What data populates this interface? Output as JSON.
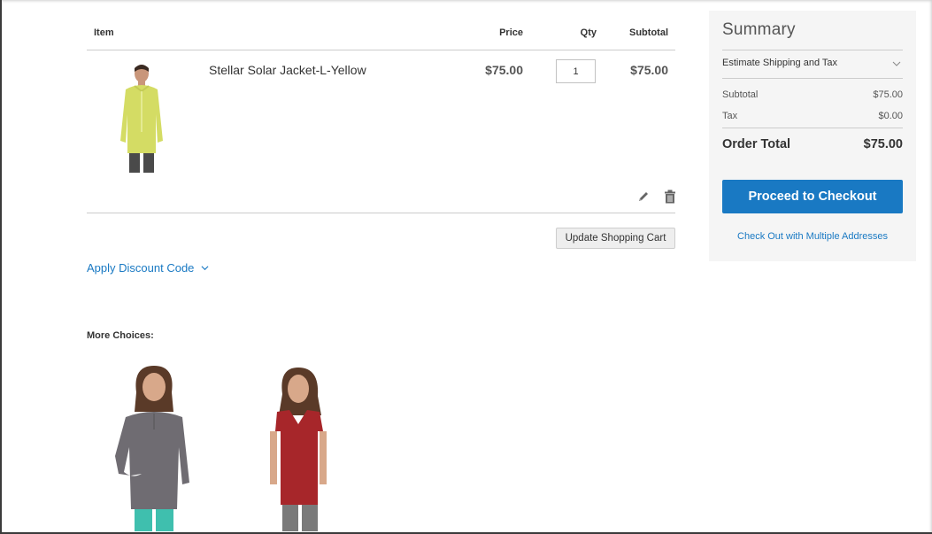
{
  "cart": {
    "headers": {
      "item": "Item",
      "price": "Price",
      "qty": "Qty",
      "subtotal": "Subtotal"
    },
    "items": [
      {
        "name": "Stellar Solar Jacket-L-Yellow",
        "price": "$75.00",
        "qty": "1",
        "subtotal": "$75.00",
        "image": "woman-in-yellow-jacket",
        "actions": [
          "edit-icon",
          "trash-icon"
        ]
      }
    ],
    "update_label": "Update Shopping Cart"
  },
  "discount": {
    "label": "Apply Discount Code"
  },
  "more_choices": {
    "title": "More Choices:",
    "items": [
      {
        "image": "woman-in-gray-quarter-zip-top"
      },
      {
        "image": "woman-in-red-v-neck-tee"
      }
    ]
  },
  "summary": {
    "title": "Summary",
    "estimate_label": "Estimate Shipping and Tax",
    "rows": [
      {
        "label": "Subtotal",
        "value": "$75.00"
      },
      {
        "label": "Tax",
        "value": "$0.00"
      }
    ],
    "order_total_label": "Order Total",
    "order_total_value": "$75.00",
    "checkout_label": "Proceed to Checkout",
    "multi_address_label": "Check Out with Multiple Addresses"
  },
  "colors": {
    "accent": "#1979c3",
    "summary_bg": "#f5f5f5"
  }
}
